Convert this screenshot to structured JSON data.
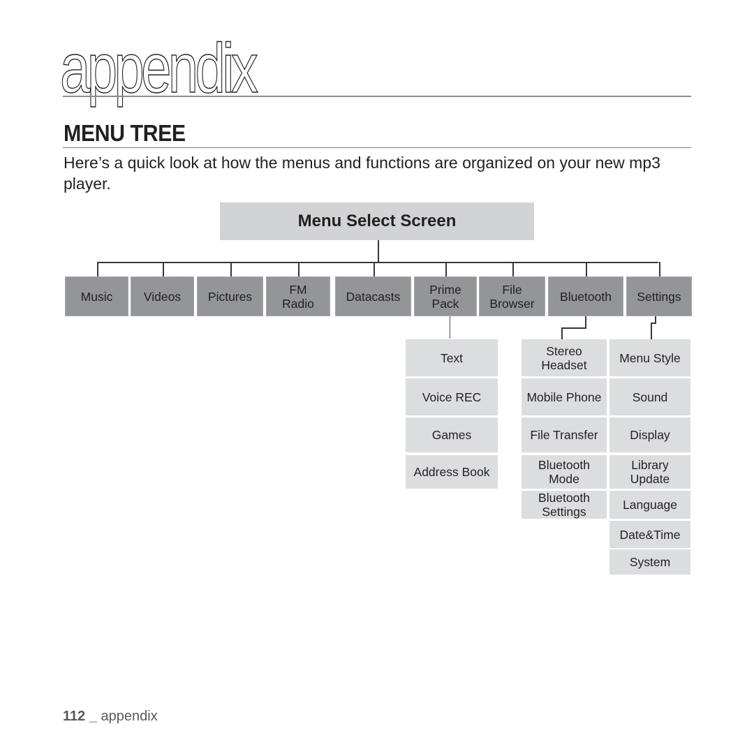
{
  "page": {
    "chapter_title": "appendix",
    "section_title": "MENU TREE",
    "intro": "Here’s a quick look at how the menus and functions are organized on your new mp3 player."
  },
  "tree": {
    "root": "Menu Select Screen",
    "top_items": [
      {
        "label": "Music"
      },
      {
        "label": "Videos"
      },
      {
        "label": "Pictures"
      },
      {
        "label": "FM\nRadio"
      },
      {
        "label": "Datacasts"
      },
      {
        "label": "Prime\nPack"
      },
      {
        "label": "File\nBrowser"
      },
      {
        "label": "Bluetooth"
      },
      {
        "label": "Settings"
      }
    ],
    "prime_pack_children": [
      "Text",
      "Voice REC",
      "Games",
      "Address Book"
    ],
    "bluetooth_children": [
      "Stereo\nHeadset",
      "Mobile Phone",
      "File Transfer",
      "Bluetooth\nMode",
      "Bluetooth\nSettings"
    ],
    "settings_children": [
      "Menu Style",
      "Sound",
      "Display",
      "Library\nUpdate",
      "Language",
      "Date&Time",
      "System"
    ]
  },
  "footer": {
    "page_number": "112",
    "separator": "_",
    "label": "appendix"
  },
  "colors": {
    "top_box": "#939598",
    "sub_box": "#dcdddf",
    "root_box": "#d2d3d5"
  }
}
